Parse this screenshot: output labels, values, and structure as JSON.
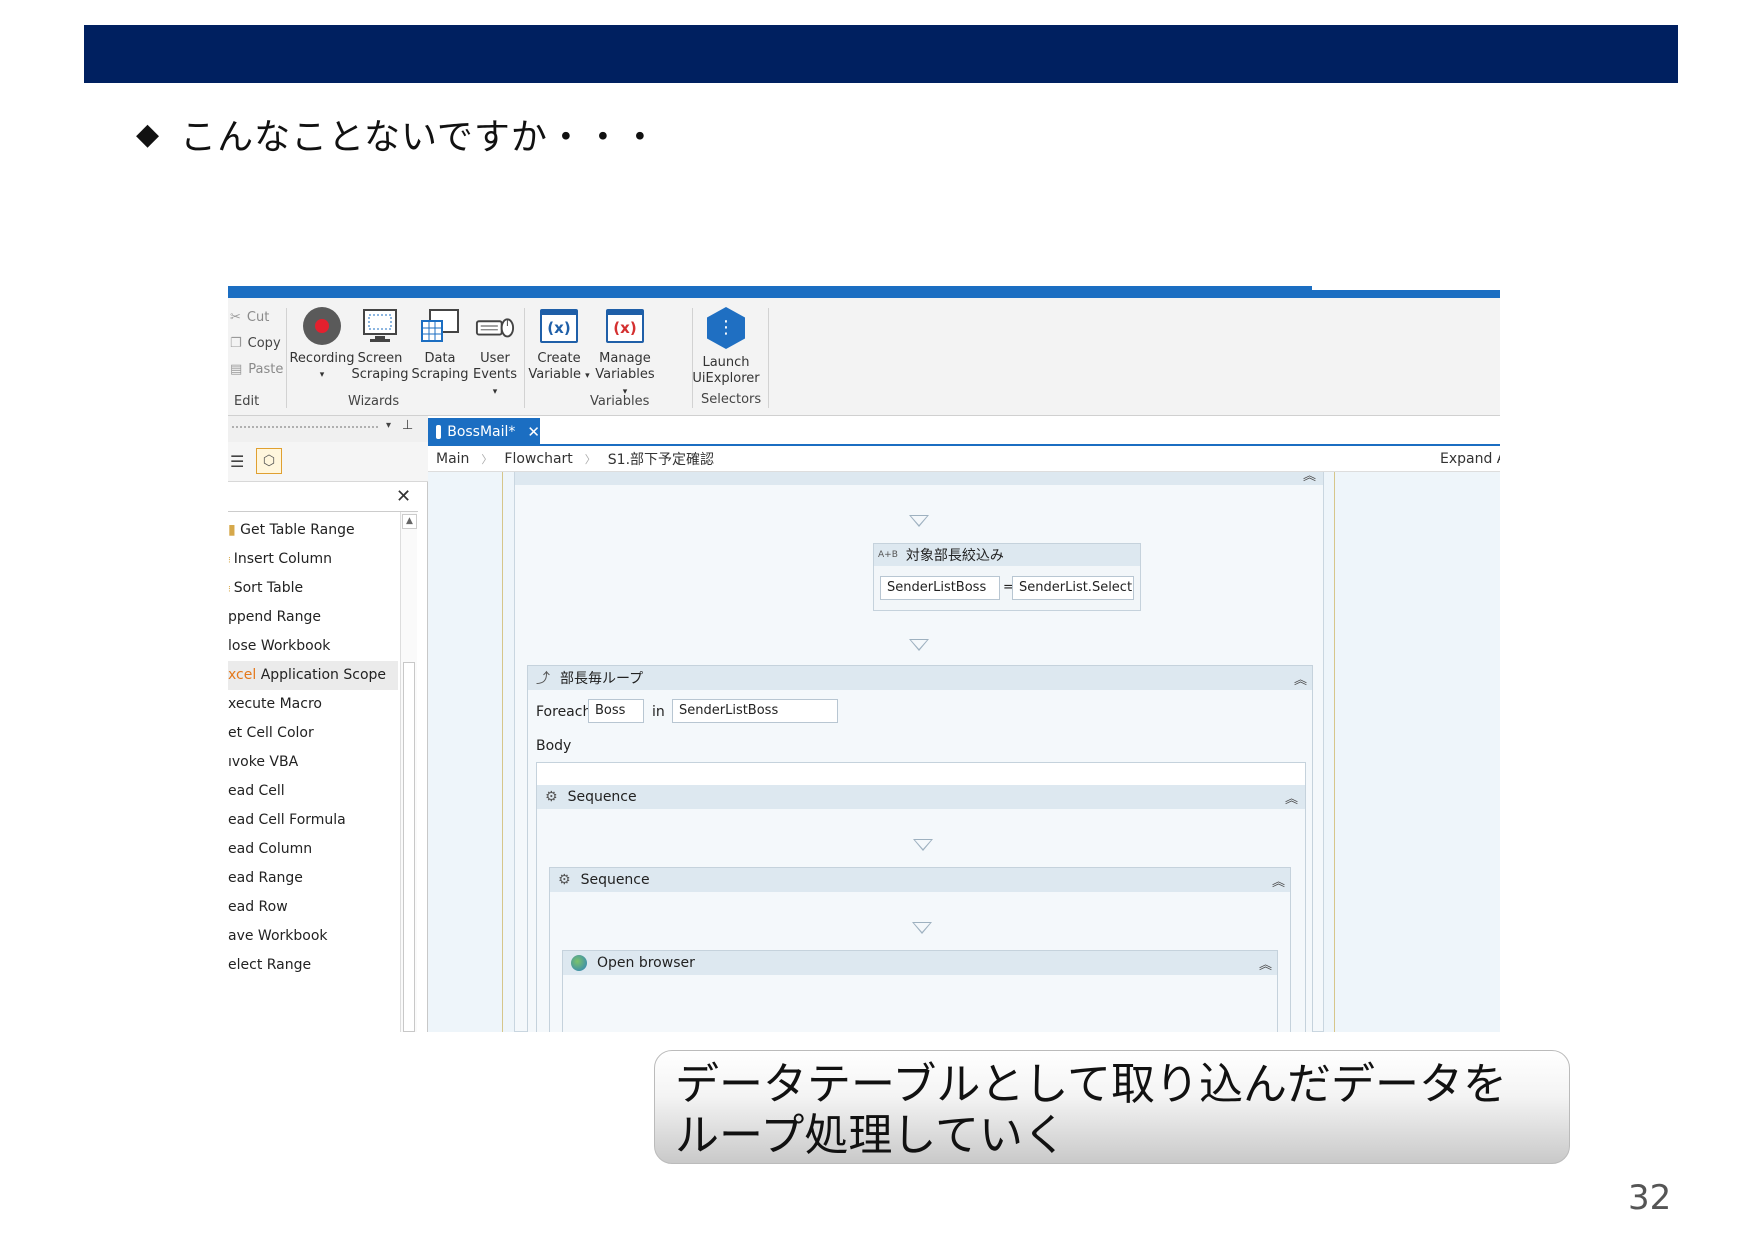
{
  "slide": {
    "bullet": "◆",
    "heading": "こんなことないですか・・・",
    "caption_line1": "データテーブルとして取り込んだデータを",
    "caption_line2": "ループ処理していく",
    "page_number": "32"
  },
  "ribbon": {
    "edit": {
      "cut": "Cut",
      "copy": "Copy",
      "paste": "Paste",
      "group": "Edit"
    },
    "wizards": {
      "recording": "Recording",
      "screen_1": "Screen",
      "screen_2": "Scraping",
      "data_1": "Data",
      "data_2": "Scraping",
      "user_1": "User",
      "user_2": "Events",
      "group": "Wizards"
    },
    "variables": {
      "create_1": "Create",
      "create_2": "Variable",
      "manage_1": "Manage",
      "manage_2": "Variables",
      "group": "Variables"
    },
    "selectors": {
      "launch_1": "Launch",
      "launch_2": "UiExplorer",
      "group": "Selectors"
    }
  },
  "activities": {
    "items": [
      "Get Table Range",
      "Insert Column",
      "Sort Table",
      "ppend Range",
      "lose Workbook",
      "Application Scope",
      "xecute Macro",
      "et Cell Color",
      "ıvoke VBA",
      "ead Cell",
      "ead Cell Formula",
      "ead Column",
      "ead Range",
      "ead Row",
      "ave Workbook",
      "elect Range"
    ],
    "selected_prefix": "xcel"
  },
  "editor": {
    "tab_label": "BossMail*",
    "breadcrumb": [
      "Main",
      "Flowchart",
      "S1.部下予定確認"
    ],
    "expand_all": "Expand A",
    "assign": {
      "title": "対象部長絞込み",
      "icon": "A+B",
      "to": "SenderListBoss",
      "eq": "=",
      "value": "SenderList.Select(\""
    },
    "foreach": {
      "title": "部長毎ループ",
      "foreach_label": "Foreach",
      "item": "Boss",
      "in_label": "in",
      "collection": "SenderListBoss",
      "body_label": "Body"
    },
    "sequence_1": "Sequence",
    "sequence_2": "Sequence",
    "open_browser": "Open browser"
  },
  "icons": {
    "cut": "scissors-icon",
    "copy": "copy-icon",
    "paste": "paste-icon",
    "recording": "record-icon",
    "screen": "screen-scraping-icon",
    "data": "data-scraping-icon",
    "user": "user-events-icon",
    "create": "create-variable-icon",
    "manage": "manage-variables-icon",
    "launch": "uiexplorer-icon"
  },
  "colors": {
    "slide_bar": "#002060",
    "accent": "#1b6ec2",
    "orange": "#e4781b",
    "record": "#e4202e"
  }
}
